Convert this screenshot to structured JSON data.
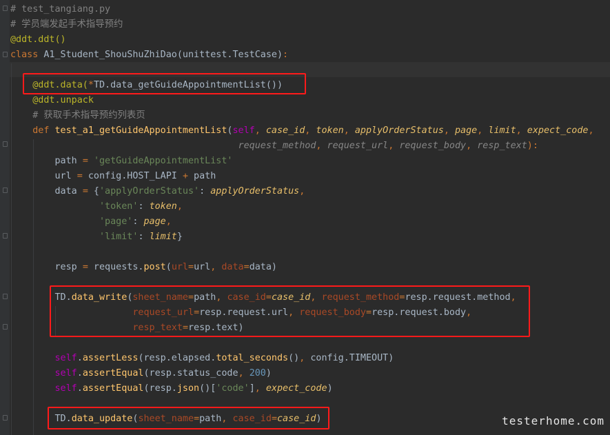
{
  "editor": {
    "lines": [
      {
        "id": "l1",
        "tokens": [
          {
            "t": "# test_tangiang.py",
            "c": "cm"
          }
        ]
      },
      {
        "id": "l2",
        "tokens": [
          {
            "t": "# 学员端发起手术指导预约",
            "c": "cm"
          }
        ]
      },
      {
        "id": "l3",
        "tokens": [
          {
            "t": "@ddt.ddt()",
            "c": "dc"
          }
        ]
      },
      {
        "id": "l4",
        "tokens": [
          {
            "t": "class",
            "c": "kw"
          },
          {
            "t": " A1_Student_ShouShuZhiDao(unittest.TestCase)"
          },
          {
            "t": ":",
            "c": "kw"
          }
        ]
      },
      {
        "id": "l5",
        "tokens": []
      },
      {
        "id": "l6",
        "tokens": [
          {
            "t": "    @ddt.data(",
            "c": "dc"
          },
          {
            "t": "*",
            "c": "kw"
          },
          {
            "t": "TD.data_getGuideAppointmentList())"
          }
        ]
      },
      {
        "id": "l7",
        "tokens": [
          {
            "t": "    @ddt.unpack",
            "c": "dc"
          }
        ]
      },
      {
        "id": "l8",
        "tokens": [
          {
            "t": "    # 获取手术指导预约列表页",
            "c": "cm"
          }
        ]
      },
      {
        "id": "l9",
        "tokens": [
          {
            "t": "    def",
            "c": "kw"
          },
          {
            "t": " "
          },
          {
            "t": "test_a1_getGuideAppointmentList",
            "c": "fn"
          },
          {
            "t": "("
          },
          {
            "t": "self",
            "c": "ca"
          },
          {
            "t": ", ",
            "c": "kw"
          },
          {
            "t": "case_id",
            "c": "pa"
          },
          {
            "t": ", ",
            "c": "kw"
          },
          {
            "t": "token",
            "c": "pa"
          },
          {
            "t": ", ",
            "c": "kw"
          },
          {
            "t": "applyOrderStatus",
            "c": "pa"
          },
          {
            "t": ", ",
            "c": "kw"
          },
          {
            "t": "page",
            "c": "pa"
          },
          {
            "t": ", ",
            "c": "kw"
          },
          {
            "t": "limit",
            "c": "pa"
          },
          {
            "t": ", ",
            "c": "kw"
          },
          {
            "t": "expect_code",
            "c": "pa"
          },
          {
            "t": ",",
            "c": "kw"
          }
        ]
      },
      {
        "id": "l10",
        "tokens": [
          {
            "t": "                                         "
          },
          {
            "t": "request_method",
            "c": "pad"
          },
          {
            "t": ", ",
            "c": "kw"
          },
          {
            "t": "request_url",
            "c": "pad"
          },
          {
            "t": ", ",
            "c": "kw"
          },
          {
            "t": "request_body",
            "c": "pad"
          },
          {
            "t": ", ",
            "c": "kw"
          },
          {
            "t": "resp_text",
            "c": "pad"
          },
          {
            "t": "):",
            "c": "kw"
          }
        ]
      },
      {
        "id": "l11",
        "tokens": [
          {
            "t": "        path "
          },
          {
            "t": "=",
            "c": "kw"
          },
          {
            "t": " "
          },
          {
            "t": "'getGuideAppointmentList'",
            "c": "st"
          }
        ]
      },
      {
        "id": "l12",
        "tokens": [
          {
            "t": "        url "
          },
          {
            "t": "=",
            "c": "kw"
          },
          {
            "t": " config.HOST_LAPI "
          },
          {
            "t": "+",
            "c": "kw"
          },
          {
            "t": " path"
          }
        ]
      },
      {
        "id": "l13",
        "tokens": [
          {
            "t": "        data "
          },
          {
            "t": "=",
            "c": "kw"
          },
          {
            "t": " {"
          },
          {
            "t": "'applyOrderStatus'",
            "c": "st"
          },
          {
            "t": ": "
          },
          {
            "t": "applyOrderStatus",
            "c": "pa"
          },
          {
            "t": ",",
            "c": "kw"
          }
        ]
      },
      {
        "id": "l14",
        "tokens": [
          {
            "t": "                "
          },
          {
            "t": "'token'",
            "c": "st"
          },
          {
            "t": ": "
          },
          {
            "t": "token",
            "c": "pa"
          },
          {
            "t": ",",
            "c": "kw"
          }
        ]
      },
      {
        "id": "l15",
        "tokens": [
          {
            "t": "                "
          },
          {
            "t": "'page'",
            "c": "st"
          },
          {
            "t": ": "
          },
          {
            "t": "page",
            "c": "pa"
          },
          {
            "t": ",",
            "c": "kw"
          }
        ]
      },
      {
        "id": "l16",
        "tokens": [
          {
            "t": "                "
          },
          {
            "t": "'limit'",
            "c": "st"
          },
          {
            "t": ": "
          },
          {
            "t": "limit",
            "c": "pa"
          },
          {
            "t": "}"
          }
        ]
      },
      {
        "id": "l17",
        "tokens": []
      },
      {
        "id": "l18",
        "tokens": [
          {
            "t": "        resp "
          },
          {
            "t": "=",
            "c": "kw"
          },
          {
            "t": " requests."
          },
          {
            "t": "post",
            "c": "fn"
          },
          {
            "t": "("
          },
          {
            "t": "url",
            "c": "pr"
          },
          {
            "t": "=",
            "c": "kw"
          },
          {
            "t": "url"
          },
          {
            "t": ", ",
            "c": "kw"
          },
          {
            "t": "data",
            "c": "pr"
          },
          {
            "t": "=",
            "c": "kw"
          },
          {
            "t": "data)"
          }
        ]
      },
      {
        "id": "l19",
        "tokens": []
      },
      {
        "id": "l20",
        "tokens": [
          {
            "t": "        TD."
          },
          {
            "t": "data_write",
            "c": "fn"
          },
          {
            "t": "("
          },
          {
            "t": "sheet_name",
            "c": "pr"
          },
          {
            "t": "=",
            "c": "kw"
          },
          {
            "t": "path"
          },
          {
            "t": ", ",
            "c": "kw"
          },
          {
            "t": "case_id",
            "c": "pr"
          },
          {
            "t": "=",
            "c": "kw"
          },
          {
            "t": "case_id",
            "c": "pa"
          },
          {
            "t": ", ",
            "c": "kw"
          },
          {
            "t": "request_method",
            "c": "pr"
          },
          {
            "t": "=",
            "c": "kw"
          },
          {
            "t": "resp.request.method"
          },
          {
            "t": ",",
            "c": "kw"
          }
        ]
      },
      {
        "id": "l21",
        "tokens": [
          {
            "t": "                      "
          },
          {
            "t": "request_url",
            "c": "pr"
          },
          {
            "t": "=",
            "c": "kw"
          },
          {
            "t": "resp.request.url"
          },
          {
            "t": ", ",
            "c": "kw"
          },
          {
            "t": "request_body",
            "c": "pr"
          },
          {
            "t": "=",
            "c": "kw"
          },
          {
            "t": "resp.request.body"
          },
          {
            "t": ",",
            "c": "kw"
          }
        ]
      },
      {
        "id": "l22",
        "tokens": [
          {
            "t": "                      "
          },
          {
            "t": "resp_text",
            "c": "pr"
          },
          {
            "t": "=",
            "c": "kw"
          },
          {
            "t": "resp.text)"
          }
        ]
      },
      {
        "id": "l23",
        "tokens": []
      },
      {
        "id": "l24",
        "tokens": [
          {
            "t": "        "
          },
          {
            "t": "self",
            "c": "ca"
          },
          {
            "t": "."
          },
          {
            "t": "assertLess",
            "c": "fn"
          },
          {
            "t": "(resp.elapsed."
          },
          {
            "t": "total_seconds",
            "c": "fn"
          },
          {
            "t": "()"
          },
          {
            "t": ", ",
            "c": "kw"
          },
          {
            "t": "config.TIMEOUT)"
          }
        ]
      },
      {
        "id": "l25",
        "tokens": [
          {
            "t": "        "
          },
          {
            "t": "self",
            "c": "ca"
          },
          {
            "t": "."
          },
          {
            "t": "assertEqual",
            "c": "fn"
          },
          {
            "t": "(resp.status_code"
          },
          {
            "t": ", ",
            "c": "kw"
          },
          {
            "t": "200",
            "c": "num"
          },
          {
            "t": ")"
          }
        ]
      },
      {
        "id": "l26",
        "tokens": [
          {
            "t": "        "
          },
          {
            "t": "self",
            "c": "ca"
          },
          {
            "t": "."
          },
          {
            "t": "assertEqual",
            "c": "fn"
          },
          {
            "t": "(resp."
          },
          {
            "t": "json",
            "c": "fn"
          },
          {
            "t": "()["
          },
          {
            "t": "'code'",
            "c": "st"
          },
          {
            "t": "]"
          },
          {
            "t": ", ",
            "c": "kw"
          },
          {
            "t": "expect_code",
            "c": "pa"
          },
          {
            "t": ")"
          }
        ]
      },
      {
        "id": "l27",
        "tokens": []
      },
      {
        "id": "l28",
        "tokens": [
          {
            "t": "        TD."
          },
          {
            "t": "data_update",
            "c": "fn"
          },
          {
            "t": "("
          },
          {
            "t": "sheet_name",
            "c": "pr"
          },
          {
            "t": "=",
            "c": "kw"
          },
          {
            "t": "path"
          },
          {
            "t": ", ",
            "c": "kw"
          },
          {
            "t": "case_id",
            "c": "pr"
          },
          {
            "t": "=",
            "c": "kw"
          },
          {
            "t": "case_id",
            "c": "pa"
          },
          {
            "t": ")"
          }
        ]
      }
    ]
  },
  "watermark": {
    "text": "testerhome.com"
  }
}
